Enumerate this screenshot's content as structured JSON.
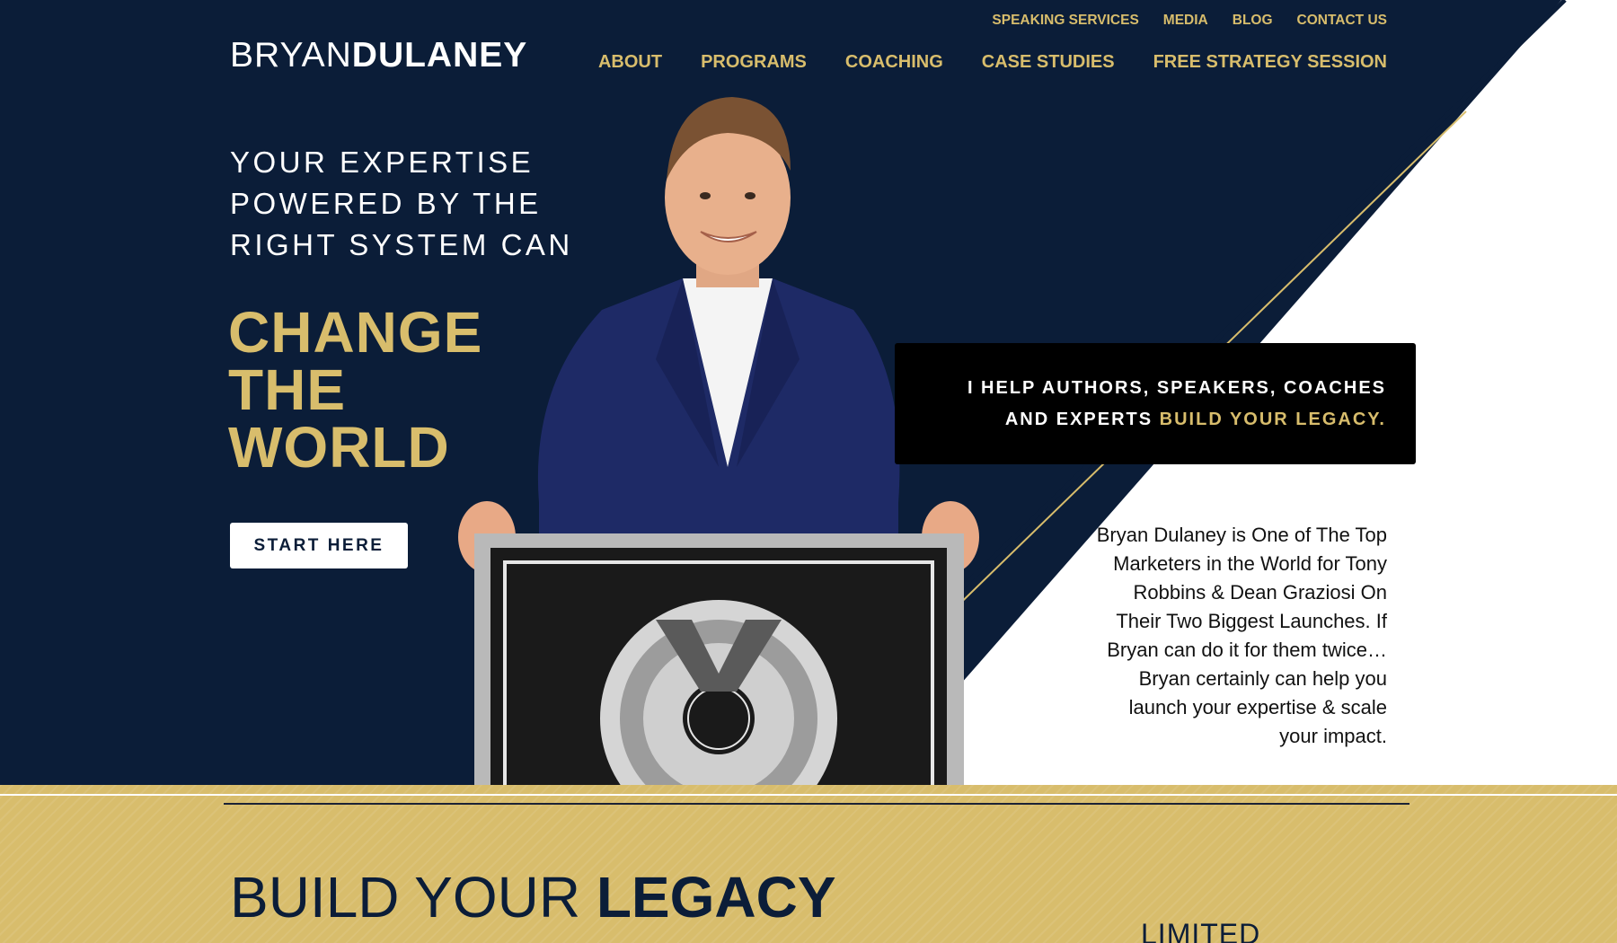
{
  "brand": {
    "logo_light": "BRYAN",
    "logo_bold": "DULANEY"
  },
  "top_nav": [
    "SPEAKING SERVICES",
    "MEDIA",
    "BLOG",
    "CONTACT US"
  ],
  "main_nav": [
    "ABOUT",
    "PROGRAMS",
    "COACHING",
    "CASE STUDIES",
    "FREE STRATEGY SESSION"
  ],
  "hero": {
    "intro_lines": [
      "YOUR EXPERTISE",
      "POWERED BY THE",
      "RIGHT SYSTEM CAN"
    ],
    "headline_lines": [
      "CHANGE",
      "THE",
      "WORLD"
    ],
    "cta_label": "START HERE"
  },
  "callout": {
    "line1": "I HELP AUTHORS, SPEAKERS, COACHES",
    "line2_white": "AND EXPERTS",
    "line2_gold": "BUILD YOUR LEGACY."
  },
  "bio_lines": [
    "Bryan Dulaney is One of The Top",
    "Marketers in the World for Tony",
    "Robbins & Dean Graziosi On",
    "Their Two Biggest Launches.  If",
    "Bryan can do it for them twice…",
    "Bryan certainly can help you",
    "launch your expertise & scale",
    "your impact."
  ],
  "legacy": {
    "title_light": "BUILD YOUR",
    "title_bold": "LEGACY",
    "limited": "LIMITED"
  },
  "colors": {
    "navy": "#0b1d38",
    "gold": "#d8bd6c",
    "black": "#000000",
    "white": "#ffffff"
  }
}
